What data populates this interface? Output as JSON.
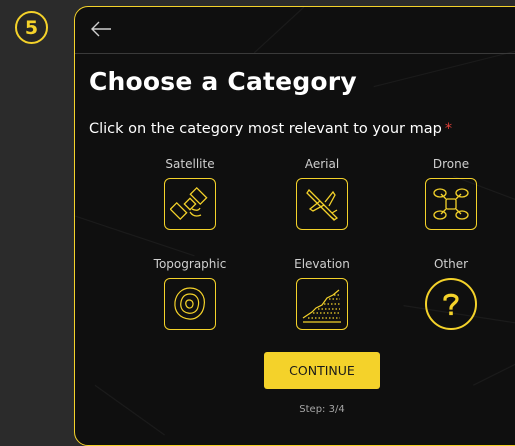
{
  "step_badge": "5",
  "header": {
    "back_icon": "arrow-left-icon"
  },
  "title": "Choose a Category",
  "subtitle": {
    "text": "Click on the category most relevant to your map",
    "required_mark": "*"
  },
  "categories": [
    {
      "label": "Satellite",
      "icon": "satellite-icon"
    },
    {
      "label": "Aerial",
      "icon": "airplane-icon"
    },
    {
      "label": "Drone",
      "icon": "drone-icon"
    },
    {
      "label": "Topographic",
      "icon": "topographic-icon"
    },
    {
      "label": "Elevation",
      "icon": "elevation-icon"
    },
    {
      "label": "Other",
      "icon": "question-mark-icon"
    }
  ],
  "continue_label": "CONTINUE",
  "step_text": "Step: 3/4",
  "colors": {
    "accent": "#f4d22a",
    "panel_bg": "#0f0f0f",
    "page_bg": "#2b2b2b",
    "required": "#e0413a"
  }
}
